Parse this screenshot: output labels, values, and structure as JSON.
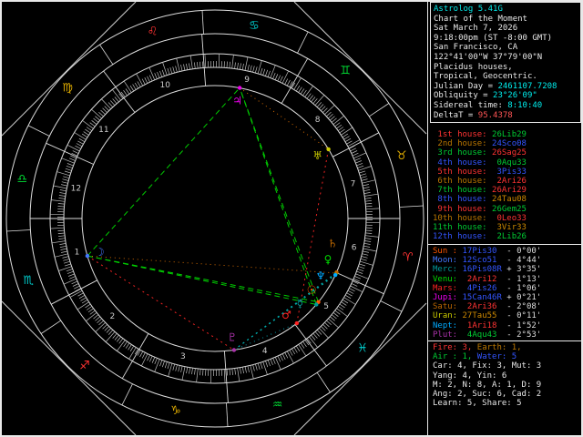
{
  "info_box": {
    "lines": [
      [
        {
          "t": "Astrolog 5.41G",
          "c": "#00eeee"
        }
      ],
      [
        {
          "t": "Chart of the Moment",
          "c": "#e8e8e8"
        }
      ],
      [
        {
          "t": "Sat March 7, 2026",
          "c": "#e8e8e8"
        }
      ],
      [
        {
          "t": "9:18:00pm (ST -8:00 GMT)",
          "c": "#e8e8e8"
        }
      ],
      [
        {
          "t": "San Francisco, CA",
          "c": "#e8e8e8"
        }
      ],
      [
        {
          "t": "122°41'00\"W 37°79'00\"N",
          "c": "#e8e8e8"
        }
      ],
      [
        {
          "t": "Placidus houses,",
          "c": "#e8e8e8"
        }
      ],
      [
        {
          "t": "Tropical, Geocentric.",
          "c": "#e8e8e8"
        }
      ],
      [
        {
          "t": "Julian Day = ",
          "c": "#e8e8e8"
        },
        {
          "t": "2461107.7208",
          "c": "#00eeee"
        }
      ],
      [
        {
          "t": "Obliquity = ",
          "c": "#e8e8e8"
        },
        {
          "t": "23°26'09\"",
          "c": "#00eeee"
        }
      ],
      [
        {
          "t": "Sidereal time: ",
          "c": "#e8e8e8"
        },
        {
          "t": "8:10:40",
          "c": "#00eeee"
        }
      ],
      [
        {
          "t": "DeltaT = ",
          "c": "#e8e8e8"
        },
        {
          "t": "95.4378",
          "c": "#ff5555"
        }
      ]
    ]
  },
  "houses": [
    {
      "label": " 1st house: ",
      "value": "26Lib29",
      "lc": "#ff3333",
      "vc": "#00cc33"
    },
    {
      "label": " 2nd house: ",
      "value": "24Sco08",
      "lc": "#bb7700",
      "vc": "#3355ff"
    },
    {
      "label": " 3rd house: ",
      "value": "26Sag25",
      "lc": "#00cc33",
      "vc": "#ff3333"
    },
    {
      "label": " 4th house: ",
      "value": " 0Aqu33",
      "lc": "#3355ff",
      "vc": "#00cc33"
    },
    {
      "label": " 5th house: ",
      "value": " 3Pis33",
      "lc": "#ff3333",
      "vc": "#3355ff"
    },
    {
      "label": " 6th house: ",
      "value": " 2Ari26",
      "lc": "#bb7700",
      "vc": "#ff3333"
    },
    {
      "label": " 7th house: ",
      "value": "26Ari29",
      "lc": "#00cc33",
      "vc": "#ff3333"
    },
    {
      "label": " 8th house: ",
      "value": "24Tau08",
      "lc": "#3355ff",
      "vc": "#cc8800"
    },
    {
      "label": " 9th house: ",
      "value": "26Gem25",
      "lc": "#ff3333",
      "vc": "#00cc33"
    },
    {
      "label": "10th house: ",
      "value": " 0Leo33",
      "lc": "#bb7700",
      "vc": "#ff3333"
    },
    {
      "label": "11th house: ",
      "value": " 3Vir33",
      "lc": "#00cc33",
      "vc": "#cc8800"
    },
    {
      "label": "12th house: ",
      "value": " 2Lib26",
      "lc": "#3355ff",
      "vc": "#00cc33"
    }
  ],
  "planet_rows": [
    {
      "name": "Sun ",
      "pos": "17Pis30",
      "lat": "- 0°00'",
      "nc": "#ff5500",
      "pc": "#3355ff"
    },
    {
      "name": "Moon",
      "pos": "12Sco51",
      "lat": "- 4°44'",
      "nc": "#4477ff",
      "pc": "#3355ff"
    },
    {
      "name": "Merc",
      "pos": "16Pis08R",
      "lat": "+ 3°35'",
      "nc": "#009999",
      "pc": "#3355ff"
    },
    {
      "name": "Venu",
      "pos": " 2Ari12",
      "lat": "- 1°13'",
      "nc": "#00dd00",
      "pc": "#ff3333"
    },
    {
      "name": "Mars",
      "pos": " 4Pis26",
      "lat": "- 1°06'",
      "nc": "#ff2222",
      "pc": "#3355ff"
    },
    {
      "name": "Jupi",
      "pos": "15Can46R",
      "lat": "+ 0°21'",
      "nc": "#ee00ee",
      "pc": "#3355ff"
    },
    {
      "name": "Satu",
      "pos": " 2Ari36",
      "lat": "- 2°08'",
      "nc": "#bb6600",
      "pc": "#ff3333"
    },
    {
      "name": "Uran",
      "pos": "27Tau55",
      "lat": "- 0°11'",
      "nc": "#cccc00",
      "pc": "#cc8800"
    },
    {
      "name": "Nept",
      "pos": " 1Ari18",
      "lat": "- 1°52'",
      "nc": "#00aaff",
      "pc": "#ff3333"
    },
    {
      "name": "Plut",
      "pos": " 4Aqu43",
      "lat": "- 2°53'",
      "nc": "#aa33aa",
      "pc": "#00cc33"
    }
  ],
  "stats": [
    [
      {
        "t": "Fire: 3, ",
        "c": "#ff3333"
      },
      {
        "t": "Earth: 1,",
        "c": "#bb7700"
      }
    ],
    [
      {
        "t": "Air : 1, ",
        "c": "#00cc33"
      },
      {
        "t": "Water: 5",
        "c": "#3355ff"
      }
    ],
    [
      {
        "t": "Car: 4, Fix: 3, Mut: 3",
        "c": "#e8e8e8"
      }
    ],
    [
      {
        "t": "Yang: 4, Yin: 6",
        "c": "#e8e8e8"
      }
    ],
    [
      {
        "t": "M: 2, N: 8, A: 1, D: 9",
        "c": "#e8e8e8"
      }
    ],
    [
      {
        "t": "Ang: 2, Suc: 6, Cad: 2",
        "c": "#e8e8e8"
      }
    ],
    [
      {
        "t": "Learn: 5, Share: 5",
        "c": "#e8e8e8"
      }
    ]
  ],
  "wheel": {
    "asc_lon": 206.483,
    "signs": [
      {
        "glyph": "♈",
        "name": "aries",
        "color": "#ff3333"
      },
      {
        "glyph": "♉",
        "name": "taurus",
        "color": "#ddaa00"
      },
      {
        "glyph": "♊",
        "name": "gemini",
        "color": "#00dd33"
      },
      {
        "glyph": "♋",
        "name": "cancer",
        "color": "#00cccc"
      },
      {
        "glyph": "♌",
        "name": "leo",
        "color": "#ff3333"
      },
      {
        "glyph": "♍",
        "name": "virgo",
        "color": "#ddaa00"
      },
      {
        "glyph": "♎",
        "name": "libra",
        "color": "#00dd33"
      },
      {
        "glyph": "♏",
        "name": "scorpio",
        "color": "#00cccc"
      },
      {
        "glyph": "♐",
        "name": "sagittarius",
        "color": "#ff3333"
      },
      {
        "glyph": "♑",
        "name": "capricorn",
        "color": "#ddaa00"
      },
      {
        "glyph": "♒",
        "name": "aquarius",
        "color": "#00dd33"
      },
      {
        "glyph": "♓",
        "name": "pisces",
        "color": "#00cccc"
      }
    ],
    "house_cusps": [
      206.483,
      234.133,
      266.417,
      300.55,
      333.55,
      2.433,
      26.483,
      54.133,
      86.417,
      120.55,
      153.55,
      182.433
    ],
    "house_numbers": [
      "1",
      "2",
      "3",
      "4",
      "5",
      "6",
      "7",
      "8",
      "9",
      "10",
      "11",
      "12"
    ],
    "planets": [
      {
        "id": "sun",
        "glyph": "☉",
        "lon": 347.5,
        "glyph_lon": 349.98,
        "color": "#ff5500"
      },
      {
        "id": "moon",
        "glyph": "☽",
        "lon": 222.85,
        "glyph_lon": 222.85,
        "color": "#4477ff"
      },
      {
        "id": "mercury",
        "glyph": "☿",
        "lon": 346.13,
        "glyph_lon": 341.48,
        "color": "#009999"
      },
      {
        "id": "venus",
        "glyph": "♀",
        "lon": 2.2,
        "glyph_lon": 6.48,
        "color": "#00dd00"
      },
      {
        "id": "mars",
        "glyph": "♂",
        "lon": 334.43,
        "glyph_lon": 332.98,
        "color": "#ff2222"
      },
      {
        "id": "jupiter",
        "glyph": "♃",
        "lon": 105.77,
        "glyph_lon": 105.77,
        "color": "#ee00ee"
      },
      {
        "id": "saturn",
        "glyph": "♄",
        "lon": 2.6,
        "glyph_lon": 14.48,
        "color": "#bb6600"
      },
      {
        "id": "uranus",
        "glyph": "♅",
        "lon": 57.92,
        "glyph_lon": 57.92,
        "color": "#cccc00"
      },
      {
        "id": "neptune",
        "glyph": "♆",
        "lon": 1.3,
        "glyph_lon": 357.98,
        "color": "#00aaff"
      },
      {
        "id": "pluto",
        "glyph": "♇",
        "lon": 304.72,
        "glyph_lon": 304.72,
        "color": "#aa33aa"
      }
    ],
    "aspects": [
      {
        "p1": "moon",
        "p2": "jupiter",
        "type": "trine"
      },
      {
        "p1": "moon",
        "p2": "sun",
        "type": "trine"
      },
      {
        "p1": "moon",
        "p2": "mercury",
        "type": "trine"
      },
      {
        "p1": "sun",
        "p2": "jupiter",
        "type": "trine"
      },
      {
        "p1": "mercury",
        "p2": "jupiter",
        "type": "trine"
      },
      {
        "p1": "pluto",
        "p2": "venus",
        "type": "sextile"
      },
      {
        "p1": "pluto",
        "p2": "saturn",
        "type": "sextile"
      },
      {
        "p1": "pluto",
        "p2": "neptune",
        "type": "sextile"
      },
      {
        "p1": "mars",
        "p2": "uranus",
        "type": "square"
      },
      {
        "p1": "moon",
        "p2": "pluto",
        "type": "square"
      },
      {
        "p1": "moon",
        "p2": "venus",
        "type": "sesquiquadrate"
      },
      {
        "p1": "jupiter",
        "p2": "uranus",
        "type": "semisquare"
      },
      {
        "p1": "mars",
        "p2": "pluto",
        "type": "semisextile"
      },
      {
        "p1": "sun",
        "p2": "mercury",
        "type": "conjunction"
      },
      {
        "p1": "venus",
        "p2": "saturn",
        "type": "conjunction"
      },
      {
        "p1": "venus",
        "p2": "neptune",
        "type": "conjunction"
      },
      {
        "p1": "saturn",
        "p2": "neptune",
        "type": "conjunction"
      }
    ],
    "aspect_colors": {
      "trine": "#00cc00",
      "sextile": "#00aaaa",
      "square": "#ee2222",
      "conjunction": "#dddd00",
      "sesquiquadrate": "#cc6600",
      "semisquare": "#cc6600",
      "semisextile": "#0099aa"
    }
  }
}
